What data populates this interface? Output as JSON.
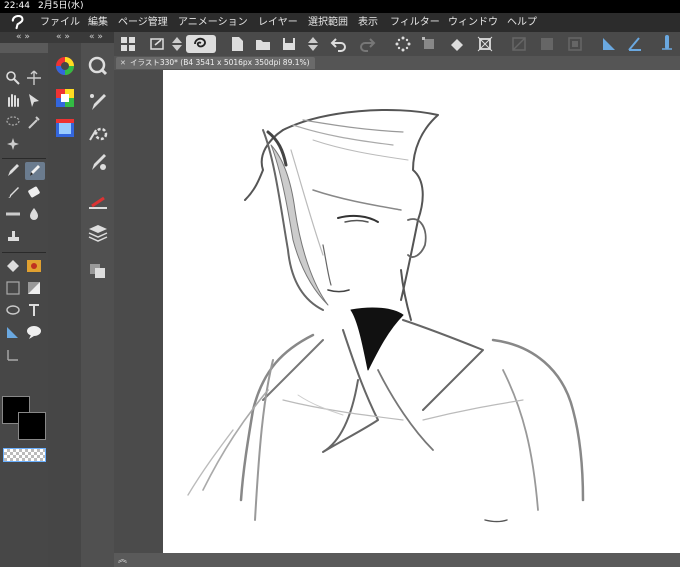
{
  "status": {
    "time": "22:44",
    "date": "2月5日(水)"
  },
  "menu": [
    "ファイル",
    "編集",
    "ページ管理",
    "アニメーション",
    "レイヤー",
    "選択範囲",
    "表示",
    "フィルター",
    "ウィンドウ",
    "ヘルプ"
  ],
  "toolbar_icons": [
    "grid-icon",
    "export-icon",
    "updown-icon",
    "app-logo-icon",
    "new-page-icon",
    "open-folder-icon",
    "save-icon",
    "updown-icon",
    "undo-icon",
    "redo-icon",
    "loading-icon",
    "transform-icon",
    "fill-icon",
    "crop-icon",
    "disabled-icon",
    "disabled-icon",
    "disabled-icon",
    "ruler-icon",
    "angle-icon",
    "pen-pressure-icon"
  ],
  "document_tab": {
    "title": "イラスト330* (B4 3541 x 5016px 350dpi 89.1%)"
  },
  "left_panel": {
    "tools": [
      "zoom-icon",
      "move-icon",
      "hand-icon",
      "object-select-icon",
      "lasso-icon",
      "eyedropper-icon",
      "sparkle-icon",
      "pen-icon",
      "pencil-icon",
      "brush-icon",
      "eraser-icon",
      "line-icon",
      "blend-icon",
      "stamp-icon",
      "fill-icon",
      "gradient-icon",
      "frame-icon",
      "shape-icon",
      "text-icon",
      "ruler-icon",
      "speech-balloon-icon",
      "correction-icon"
    ],
    "colors": {
      "main": "#000000",
      "sub": "#000000"
    }
  },
  "palette_column": [
    "color-wheel-icon",
    "color-set-icon",
    "color-history-icon"
  ],
  "sub_tools": [
    "quick-access-icon",
    "sub-tool-1-icon",
    "sub-tool-settings-icon",
    "sub-tool-3-icon",
    "brush-size-icon",
    "layers-icon",
    "layer-property-icon"
  ]
}
